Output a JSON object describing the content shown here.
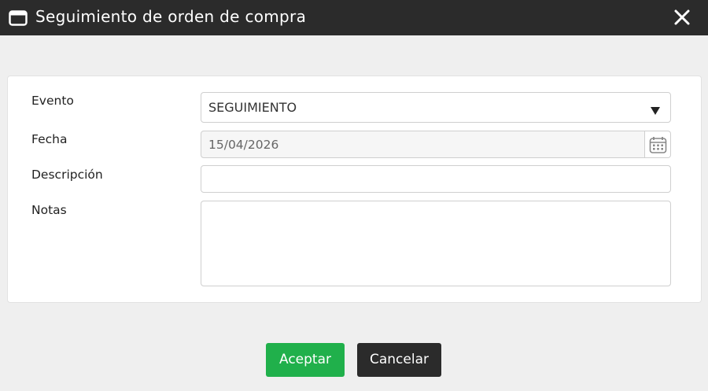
{
  "dialog": {
    "title": "Seguimiento de orden de compra",
    "title_icon": "window-icon",
    "close_icon": "close-icon"
  },
  "form": {
    "evento": {
      "label": "Evento",
      "value": "SEGUIMIENTO",
      "icon": "caret-down-icon"
    },
    "fecha": {
      "label": "Fecha",
      "value": "15/04/2026",
      "icon": "calendar-icon"
    },
    "descripcion": {
      "label": "Descripción",
      "value": ""
    },
    "notas": {
      "label": "Notas",
      "value": ""
    }
  },
  "buttons": {
    "accept_label": "Aceptar",
    "cancel_label": "Cancelar"
  },
  "colors": {
    "titlebar": "#2b2b2b",
    "accept": "#20b04b",
    "cancel": "#2b2b2b",
    "background": "#efefef"
  }
}
